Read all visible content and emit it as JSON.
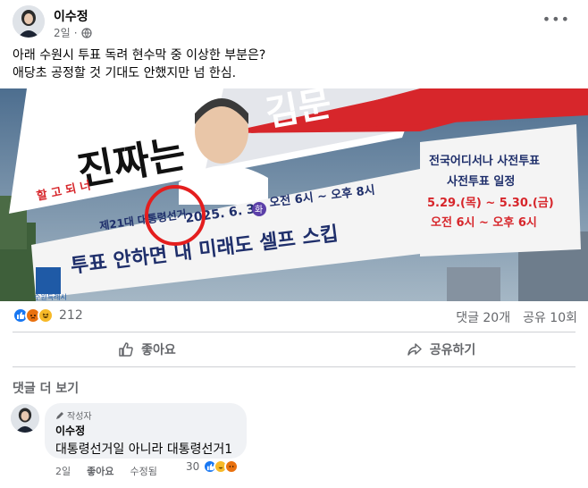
{
  "post": {
    "author": "이수정",
    "time": "2일",
    "text_line1": "아래 수원시 투표 독려 현수막 중 이상한 부분은?",
    "text_line2": "애당초 공정할 것 기대도 안했지만 넘 한심."
  },
  "banner": {
    "red_text": "진짜는",
    "red_small": "할 고 되 너",
    "red_right": "김문",
    "main_line1": "제21대 대통령선거",
    "date": "2025. 6. 3.",
    "day": "화",
    "time_range": "오전 6시 ~ 오후 8시",
    "slogan": "투표 안하면 내 미래도 셀프 스킵",
    "org": "수원특례시",
    "right_title": "전국어디서나 사전투표",
    "right_sub": "사전투표 일정",
    "right_dates": "5.29.(목) ~ 5.30.(금)",
    "right_time": "오전 6시 ~ 오후 6시"
  },
  "stats": {
    "reaction_count": "212",
    "comments": "댓글 20개",
    "shares": "공유 10회"
  },
  "actions": {
    "like": "좋아요",
    "share": "공유하기"
  },
  "comments": {
    "more": "댓글 더 보기",
    "items": [
      {
        "badge": "작성자",
        "author": "이수정",
        "text": "대통령선거일 아니라 대통령선거1",
        "time": "2일",
        "like": "좋아요",
        "edited": "수정됨",
        "react_count": "30"
      }
    ]
  },
  "colors": {
    "like_blue": "#1877f2",
    "haha_yellow": "#f7b928",
    "angry_orange": "#e9710f",
    "highlight_red": "#e41e1e"
  }
}
